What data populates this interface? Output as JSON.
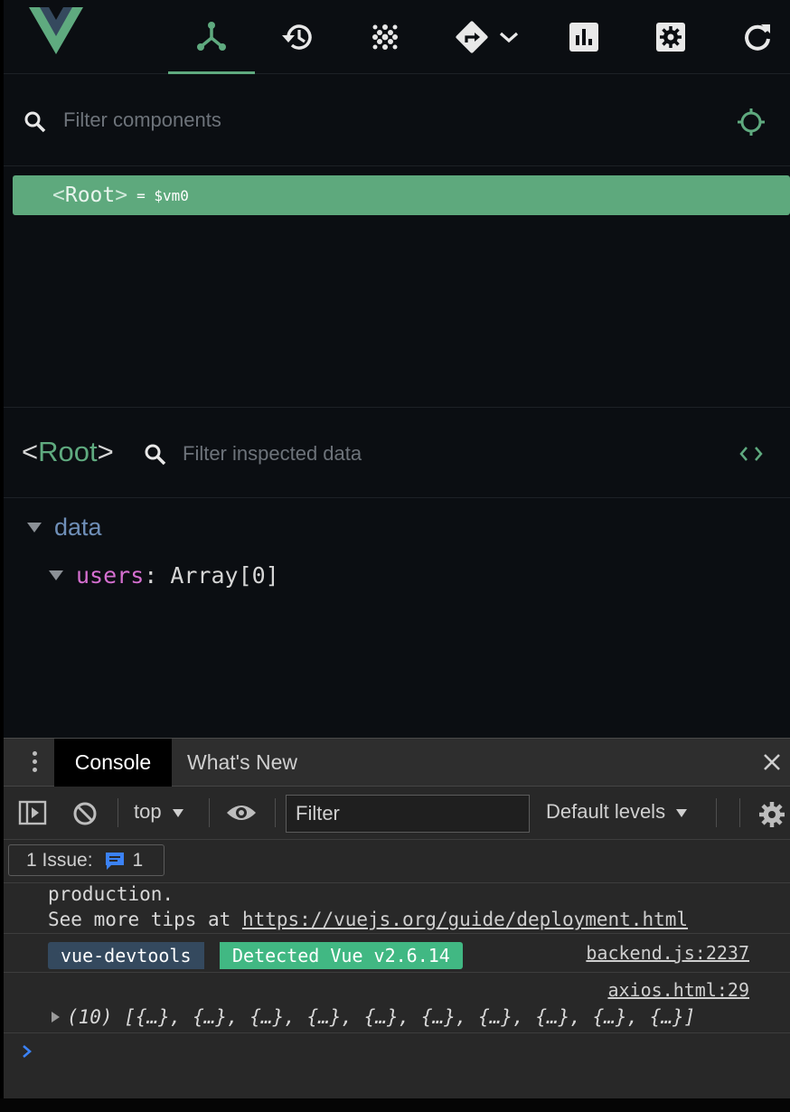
{
  "devtools": {
    "toolbar_icons": [
      "vue-logo-icon",
      "components-icon",
      "timeline-icon",
      "vuex-icon",
      "routing-icon",
      "performance-icon",
      "settings-icon",
      "refresh-icon"
    ],
    "component_filter_placeholder": "Filter components",
    "root_component": {
      "open": "<",
      "name": "Root",
      "close": ">",
      "vm": "= $vm0"
    },
    "inspector": {
      "title_open": "<",
      "title_name": "Root",
      "title_close": ">",
      "filter_placeholder": "Filter inspected data",
      "section": "data",
      "fields": [
        {
          "key": "users",
          "colon": ":",
          "value": "Array[0]"
        }
      ]
    }
  },
  "console": {
    "tabs": [
      "Console",
      "What's New"
    ],
    "context": "top",
    "filter_text": "Filter",
    "levels": "Default levels",
    "issues_label": "1 Issue:",
    "issues_count": "1",
    "messages": {
      "line1": "production.",
      "line2_prefix": "See more tips at ",
      "line2_link": "https://vuejs.org/guide/deployment.html",
      "badge_left": "vue-devtools",
      "badge_right": "Detected Vue v2.6.14",
      "src1": "backend.js:2237",
      "src2": "axios.html:29",
      "array_preview": "(10) [{…}, {…}, {…}, {…}, {…}, {…}, {…}, {…}, {…}, {…}]"
    },
    "prompt": "›"
  },
  "colors": {
    "vue_green": "#5faa7f",
    "background": "#0b0e12",
    "console_bg": "#282828",
    "badge_dark": "#34495e",
    "badge_green": "#41b883"
  }
}
